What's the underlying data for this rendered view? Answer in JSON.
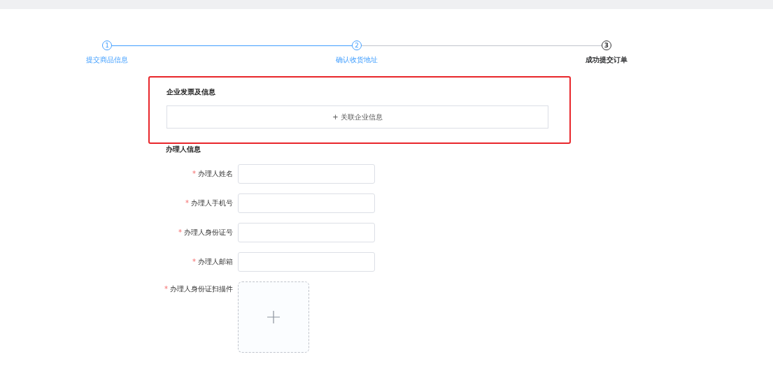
{
  "steps": [
    {
      "number": "1",
      "label": "提交商品信息",
      "done": true,
      "current": false
    },
    {
      "number": "2",
      "label": "确认收货地址",
      "done": true,
      "current": false
    },
    {
      "number": "3",
      "label": "成功提交订单",
      "done": false,
      "current": true
    }
  ],
  "company_section": {
    "title": "企业发票及信息",
    "link_label": "+ 关联企业信息",
    "highlighted": true
  },
  "handler_section": {
    "title": "办理人信息",
    "fields": [
      {
        "kind": "input",
        "label": "办理人姓名",
        "required_mark": "*"
      },
      {
        "kind": "input",
        "label": "办理人手机号",
        "required_mark": "*"
      },
      {
        "kind": "input",
        "label": "办理人身份证号",
        "required_mark": "*"
      },
      {
        "kind": "input",
        "label": "办理人邮箱",
        "required_mark": "*"
      },
      {
        "kind": "upload",
        "label": "办理人身份证扫描件",
        "required_mark": "*"
      }
    ]
  }
}
